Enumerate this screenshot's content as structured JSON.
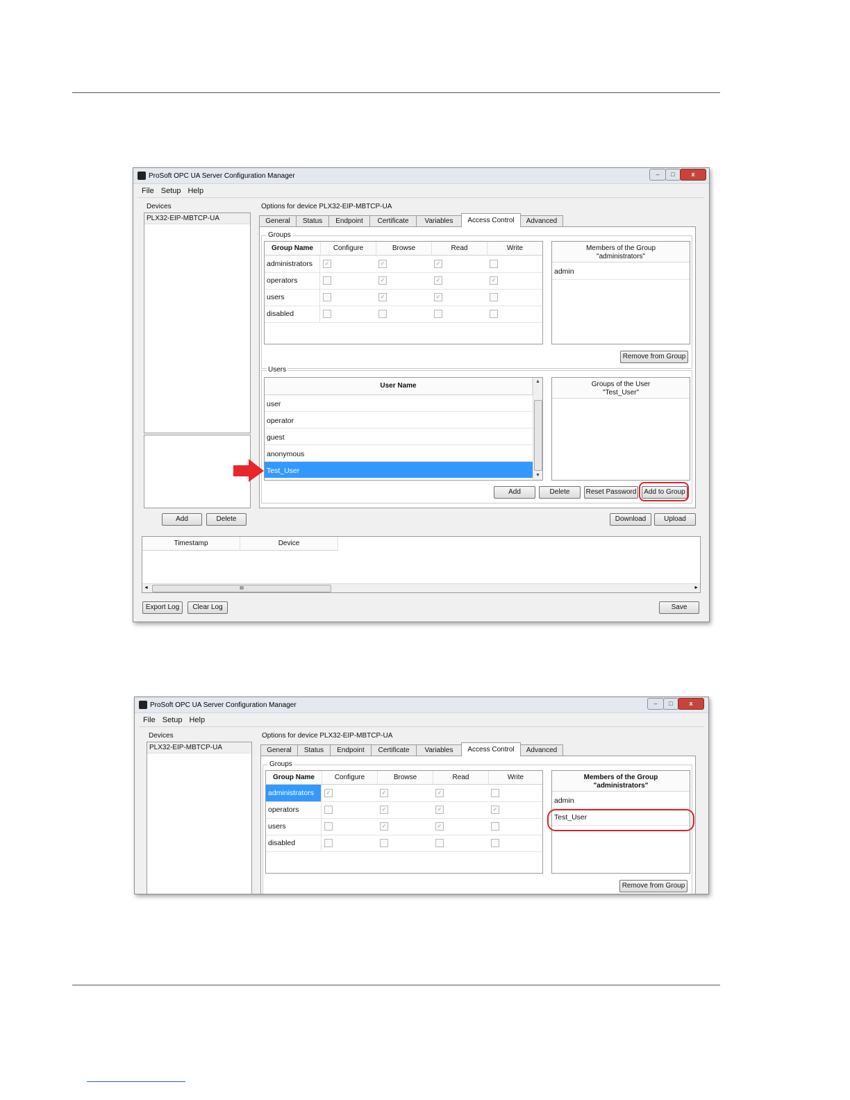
{
  "window": {
    "title": "ProSoft OPC UA Server Configuration Manager",
    "controls": [
      "–",
      "□",
      "x"
    ]
  },
  "menu": {
    "file": "File",
    "setup": "Setup",
    "help": "Help"
  },
  "devices": {
    "label": "Devices",
    "items": [
      "PLX32-EIP-MBTCP-UA"
    ],
    "add_label": "Add",
    "delete_label": "Delete"
  },
  "options_label": "Options for device PLX32-EIP-MBTCP-UA",
  "tabs": [
    "General",
    "Status",
    "Endpoint",
    "Certificate",
    "Variables",
    "Access Control",
    "Advanced"
  ],
  "groups": {
    "label": "Groups",
    "columns": [
      "Group Name",
      "Configure",
      "Browse",
      "Read",
      "Write"
    ],
    "rows": [
      {
        "name": "administrators",
        "configure": true,
        "browse": true,
        "read": true,
        "write": false
      },
      {
        "name": "operators",
        "configure": false,
        "browse": true,
        "read": true,
        "write": true
      },
      {
        "name": "users",
        "configure": false,
        "browse": true,
        "read": true,
        "write": false
      },
      {
        "name": "disabled",
        "configure": false,
        "browse": false,
        "read": false,
        "write": false
      }
    ],
    "members_header_line1": "Members of the Group",
    "members_header_line2": "\"administrators\"",
    "members_before": [
      "admin"
    ],
    "members_after": [
      "admin",
      "Test_User"
    ],
    "remove_label": "Remove from Group"
  },
  "users": {
    "label": "Users",
    "column": "User Name",
    "rows": [
      "user",
      "operator",
      "guest",
      "anonymous",
      "Test_User"
    ],
    "selected": "Test_User",
    "groups_header_line1": "Groups of the User",
    "groups_header_line2": "\"Test_User\"",
    "add_label": "Add",
    "delete_label": "Delete",
    "reset_label": "Reset Password",
    "add_to_group_label": "Add to Group"
  },
  "actions": {
    "download": "Download",
    "upload": "Upload"
  },
  "log": {
    "columns": [
      "Timestamp",
      "Device"
    ],
    "scroll_thumb_glyph": "III",
    "export_label": "Export Log",
    "clear_label": "Clear Log",
    "save_label": "Save"
  },
  "colors": {
    "selection": "#3399ff",
    "highlight": "#d8232a",
    "arrow": "#e8262b"
  }
}
